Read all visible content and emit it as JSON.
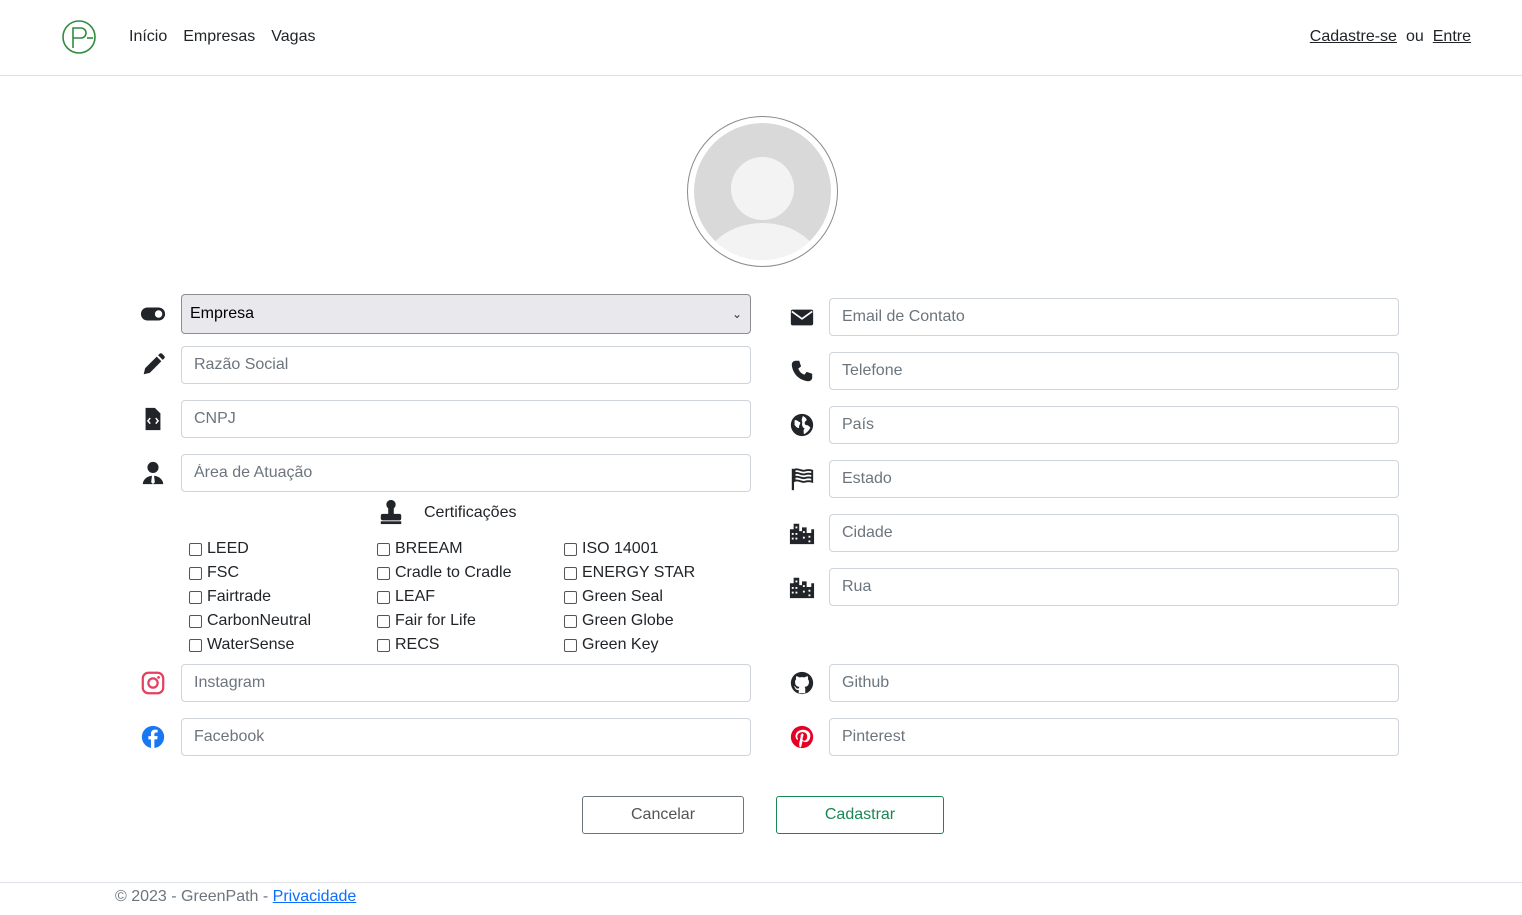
{
  "nav": {
    "links": [
      "Início",
      "Empresas",
      "Vagas"
    ],
    "signup": "Cadastre-se",
    "or": "ou",
    "login": "Entre"
  },
  "form": {
    "type_select": "Empresa",
    "left_fields": [
      {
        "placeholder": "Razão Social",
        "icon": "pencil-icon"
      },
      {
        "placeholder": "CNPJ",
        "icon": "file-code-icon"
      },
      {
        "placeholder": "Área de Atuação",
        "icon": "user-tie-icon"
      }
    ],
    "right_fields": [
      {
        "placeholder": "Email de Contato",
        "icon": "envelope-icon"
      },
      {
        "placeholder": "Telefone",
        "icon": "phone-icon"
      },
      {
        "placeholder": "País",
        "icon": "globe-icon"
      },
      {
        "placeholder": "Estado",
        "icon": "flag-icon"
      },
      {
        "placeholder": "Cidade",
        "icon": "city-icon"
      },
      {
        "placeholder": "Rua",
        "icon": "city-icon"
      }
    ],
    "certifications_title": "Certificações",
    "certifications": [
      [
        "LEED",
        "FSC",
        "Fairtrade",
        "CarbonNeutral",
        "WaterSense"
      ],
      [
        "BREEAM",
        "Cradle to Cradle",
        "LEAF",
        "Fair for Life",
        "RECS"
      ],
      [
        "ISO 14001",
        "ENERGY STAR",
        "Green Seal",
        "Green Globe",
        "Green Key"
      ]
    ],
    "social": {
      "instagram": "Instagram",
      "facebook": "Facebook",
      "github": "Github",
      "pinterest": "Pinterest"
    },
    "cancel_label": "Cancelar",
    "submit_label": "Cadastrar"
  },
  "colors": {
    "brand_green": "#198754",
    "instagram": "#e4405f",
    "facebook": "#1877f2",
    "pinterest": "#e60023"
  },
  "footer": {
    "text": "© 2023 - GreenPath -",
    "privacy": "Privacidade"
  }
}
